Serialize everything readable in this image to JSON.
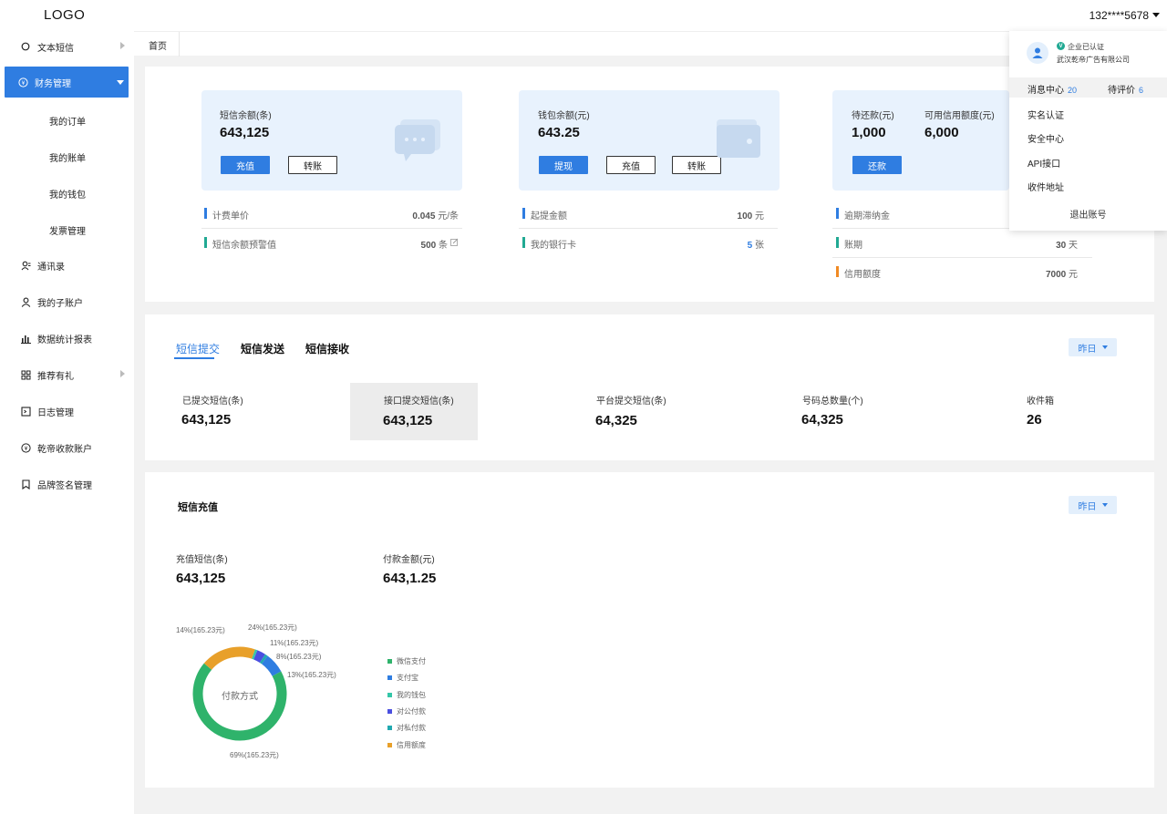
{
  "app": {
    "logo": "LOGO"
  },
  "user": {
    "phone": "132****5678"
  },
  "breadcrumb": {
    "home": "首页"
  },
  "sidebar": {
    "items": [
      {
        "label": "文本短信",
        "icon": "circle-icon",
        "has_arrow": true
      },
      {
        "label": "财务管理",
        "icon": "yen-icon",
        "active": true
      },
      {
        "label": "通讯录",
        "icon": "contacts-icon"
      },
      {
        "label": "我的子账户",
        "icon": "person-icon"
      },
      {
        "label": "数据统计报表",
        "icon": "bar-chart-icon"
      },
      {
        "label": "推荐有礼",
        "icon": "grid-icon",
        "has_arrow": true
      },
      {
        "label": "日志管理",
        "icon": "log-icon"
      },
      {
        "label": "乾帝收款账户",
        "icon": "yen-icon"
      },
      {
        "label": "品牌签名管理",
        "icon": "bookmark-icon"
      }
    ],
    "sub_items": [
      "我的订单",
      "我的账单",
      "我的钱包",
      "发票管理"
    ]
  },
  "overview": {
    "sms_card": {
      "label": "短信余额(条)",
      "value": "643,125",
      "btn_recharge": "充值",
      "btn_transfer": "转账"
    },
    "wallet_card": {
      "label": "钱包余额(元)",
      "value": "643.25",
      "btn_withdraw": "提现",
      "btn_recharge": "充值",
      "btn_transfer": "转账"
    },
    "credit_card": {
      "label_due": "待还款(元)",
      "value_due": "1,000",
      "label_credit": "可用信用额度(元)",
      "value_credit": "6,000",
      "btn_repay": "还款"
    },
    "sms_info": [
      {
        "label": "计费单价",
        "value": "0.045",
        "unit": "元/条",
        "color": "#2f7de1"
      },
      {
        "label": "短信余额预警值",
        "value": "500",
        "unit": "条",
        "color": "#21a993"
      }
    ],
    "wallet_info": [
      {
        "label": "起提金额",
        "value": "100",
        "unit": "元",
        "color": "#2f7de1"
      },
      {
        "label": "我的银行卡",
        "value": "5",
        "unit": "张",
        "color": "#21a993"
      }
    ],
    "credit_info": [
      {
        "label": "逾期滞纳金",
        "value": "",
        "unit": "",
        "color": "#2f7de1"
      },
      {
        "label": "账期",
        "value": "30",
        "unit": "天",
        "color": "#21a993"
      },
      {
        "label": "信用额度",
        "value": "7000",
        "unit": "元",
        "color": "#f08a24"
      }
    ]
  },
  "sms_stats": {
    "tabs": [
      "短信提交",
      "短信发送",
      "短信接收"
    ],
    "range": "昨日",
    "stats": [
      {
        "label": "已提交短信(条)",
        "value": "643,125"
      },
      {
        "label": "接口提交短信(条)",
        "value": "643,125"
      },
      {
        "label": "平台提交短信(条)",
        "value": "64,325"
      },
      {
        "label": "号码总数量(个)",
        "value": "64,325"
      },
      {
        "label": "收件箱",
        "value": "26"
      }
    ]
  },
  "recharge": {
    "title": "短信充值",
    "range": "昨日",
    "sms_label": "充值短信(条)",
    "sms_value": "643,125",
    "amount_label": "付款金额(元)",
    "amount_value": "643,1.25",
    "pie_center": "付款方式",
    "pie_labels": [
      "14%(165.23元)",
      "24%(165.23元)",
      "11%(165.23元)",
      "8%(165.23元)",
      "13%(165.23元)",
      "69%(165.23元)"
    ]
  },
  "chart_data": {
    "type": "pie",
    "title": "",
    "center_label": "付款方式",
    "legend": [
      "微信支付",
      "支付宝",
      "我的钱包",
      "对公付款",
      "对私付款",
      "信用额度"
    ],
    "slices": [
      {
        "name": "微信支付",
        "value": 69,
        "color": "#2fb36b"
      },
      {
        "name": "支付宝",
        "value": 7,
        "color": "#2f7de1"
      },
      {
        "name": "我的钱包",
        "value": 1,
        "color": "#34c6a8"
      },
      {
        "name": "对公付款",
        "value": 3,
        "color": "#4a4fe0"
      },
      {
        "name": "对私付款",
        "value": 1,
        "color": "#21a9b0"
      },
      {
        "name": "信用额度",
        "value": 19,
        "color": "#e8a02a"
      }
    ]
  },
  "dropdown_menu": {
    "verified": "企业已认证",
    "company": "武汉乾帝广告有限公司",
    "msg_label": "消息中心",
    "msg_count": "20",
    "review_label": "待评价",
    "review_count": "6",
    "items": [
      "实名认证",
      "安全中心",
      "API接口",
      "收件地址"
    ],
    "logout": "退出账号"
  }
}
